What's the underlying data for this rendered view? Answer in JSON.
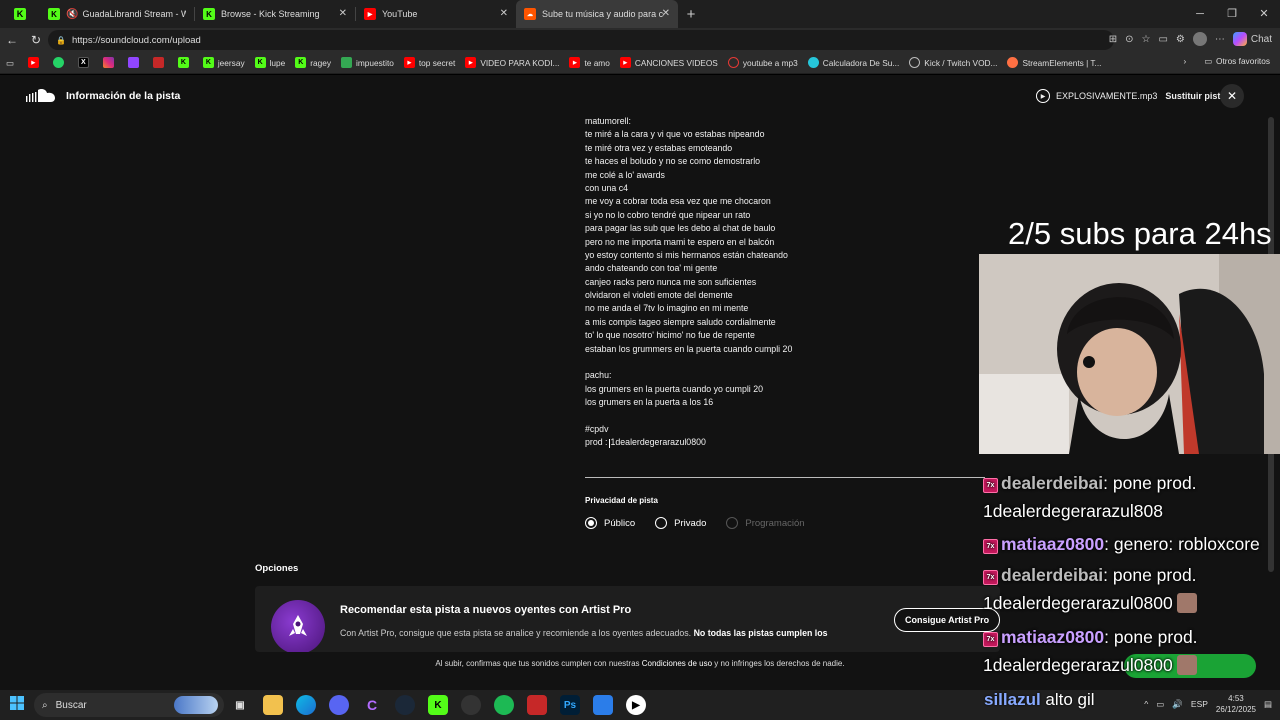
{
  "browser": {
    "tabs": [
      {
        "label": "GuadaLibrandi Stream - Watc",
        "favicon_color": "#53fc18"
      },
      {
        "label": "Browse - Kick Streaming",
        "favicon_color": "#53fc18"
      },
      {
        "label": "YouTube",
        "favicon_color": "#ff0000"
      },
      {
        "label": "Sube tu música y audio para comp",
        "favicon_color": "#ff5500"
      }
    ],
    "url": "https://soundcloud.com/upload",
    "chat_label": "Chat",
    "bookmarks": [
      {
        "label": "jeersay",
        "icon": "kick-icon",
        "color": "#53fc18"
      },
      {
        "label": "lupe",
        "icon": "kick-icon",
        "color": "#53fc18"
      },
      {
        "label": "ragey",
        "icon": "kick-icon",
        "color": "#53fc18"
      },
      {
        "label": "impuestito",
        "icon": "sheet-icon",
        "color": "#34a853"
      },
      {
        "label": "top secret",
        "icon": "youtube-icon",
        "color": "#ff0000"
      },
      {
        "label": "VIDEO PARA KODI...",
        "icon": "youtube-icon",
        "color": "#ff0000"
      },
      {
        "label": "te amo",
        "icon": "youtube-icon",
        "color": "#ff0000"
      },
      {
        "label": "CANCIONES VIDEOS",
        "icon": "youtube-icon",
        "color": "#ff0000"
      },
      {
        "label": "youtube a mp3",
        "icon": "convert-icon",
        "color": "#e53935"
      },
      {
        "label": "Calculadora De Su...",
        "icon": "calc-icon",
        "color": "#26c6da"
      },
      {
        "label": "Kick / Twitch VOD...",
        "icon": "globe-icon",
        "color": "#bbbbbb"
      },
      {
        "label": "StreamElements | T...",
        "icon": "streamelements-icon",
        "color": "#ff7043"
      }
    ],
    "other_favorites": "Otros favoritos"
  },
  "soundcloud": {
    "header_title": "Información de la pista",
    "file_name": "EXPLOSIVAMENTE.mp3",
    "replace_label": "Sustituir pista",
    "lyrics_block1": [
      "matumorell:",
      "te miré a la cara y vi que vo estabas nipeando",
      "te miré otra vez y estabas emoteando",
      "te haces el boludo y no se como demostrarlo",
      "me colé a lo' awards",
      "con una c4",
      "me voy a cobrar toda esa vez que me chocaron",
      "si yo no lo cobro tendré que nipear un rato",
      "para pagar las sub que les debo al chat de baulo",
      "pero no me importa mami te espero en el balcón",
      "yo estoy contento si mis hermanos están chateando",
      "ando chateando con toa' mi gente",
      "canjeo racks pero nunca me son suficientes",
      "olvidaron el violeti emote del demente",
      "no me anda el 7tv lo imagino en mi mente",
      "a mis compis tageo siempre saludo cordialmente",
      "to' lo que nosotro' hicimo' no fue de repente",
      "estaban los grummers en la puerta cuando cumpli 20"
    ],
    "lyrics_block2": [
      "pachu:",
      "los grumers en la puerta cuando yo cumpli 20",
      "los grumers en la puerta a los 16"
    ],
    "hashtag": "#cpdv",
    "prod_prefix": "prod :",
    "prod_value": "1dealerdegerarazul0800",
    "privacy_label": "Privacidad de pista",
    "privacy_options": [
      "Público",
      "Privado",
      "Programación"
    ],
    "options_title": "Opciones",
    "promo_title": "Recomendar esta pista a nuevos oyentes con Artist Pro",
    "promo_text": "Con Artist Pro, consigue que esta pista se analice y recomiende a los oyentes adecuados.",
    "promo_text_bold": "No todas las pistas cumplen los",
    "promo_button": "Consigue Artist Pro",
    "footer_pre": "Al subir, confirmas que tus sonidos cumplen con nuestras",
    "footer_link": "Condiciones de uso",
    "footer_post": "y no infringes los derechos de nadie."
  },
  "stream_overlay": {
    "subs_goal": "2/5 subs para 24hs",
    "chat": [
      {
        "user": "dealerdeibai",
        "text": ": pone prod."
      },
      {
        "user": "",
        "text": "1dealerdegerarazul808"
      },
      {
        "user": "matiaaz0800",
        "text": ": genero: robloxcore"
      },
      {
        "user": "dealerdeibai",
        "text": ": pone prod."
      },
      {
        "user": "",
        "text": "1dealerdegerarazul0800"
      },
      {
        "user": "matiaaz0800",
        "text": ": pone prod."
      },
      {
        "user": "",
        "text": "1dealerdegerarazul0800"
      }
    ],
    "bottom_user": "sillazul",
    "bottom_text": "alto gil"
  },
  "taskbar": {
    "search_label": "Buscar",
    "lang": "ESP",
    "time": "4:53",
    "date": "26/12/2025"
  }
}
